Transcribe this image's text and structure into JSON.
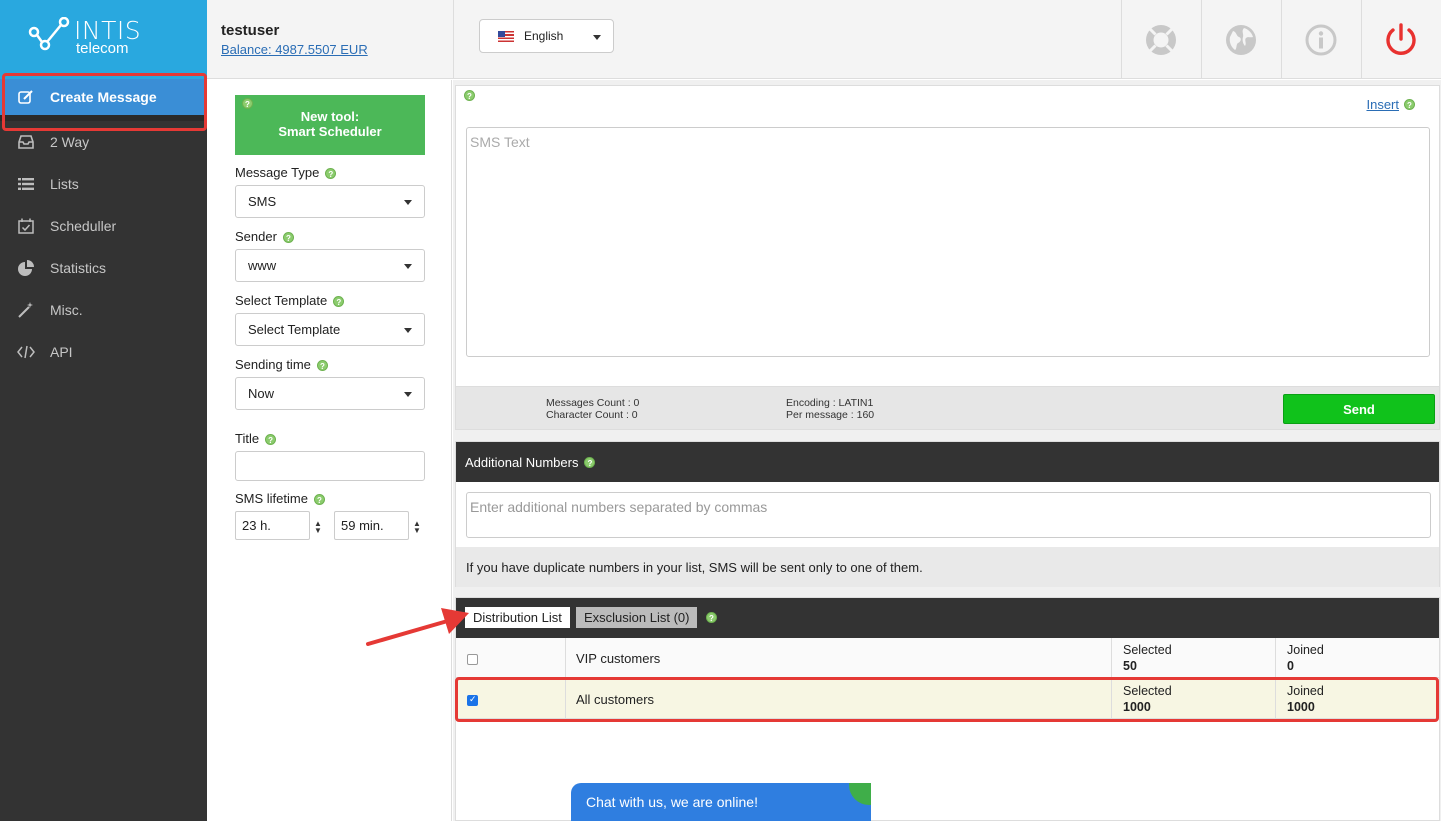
{
  "brand": {
    "line1": "INTIS",
    "line2": "telecom"
  },
  "sidebar": {
    "items": [
      {
        "label": "Create Message",
        "icon": "edit-icon",
        "active": true
      },
      {
        "label": "2 Way",
        "icon": "inbox-icon"
      },
      {
        "label": "Lists",
        "icon": "list-icon"
      },
      {
        "label": "Scheduller",
        "icon": "calendar-check-icon"
      },
      {
        "label": "Statistics",
        "icon": "pie-chart-icon"
      },
      {
        "label": "Misc.",
        "icon": "magic-wand-icon"
      },
      {
        "label": "API",
        "icon": "code-icon"
      }
    ]
  },
  "header": {
    "username": "testuser",
    "balance": "Balance: 4987.5507 EUR",
    "language": "English",
    "icons": [
      "lifebuoy-icon",
      "globe-icon",
      "info-icon",
      "power-icon"
    ]
  },
  "form": {
    "promo_line1": "New tool:",
    "promo_line2": "Smart Scheduler",
    "message_type_label": "Message Type",
    "message_type_value": "SMS",
    "sender_label": "Sender",
    "sender_value": "www",
    "template_label": "Select Template",
    "template_value": "Select Template",
    "sending_time_label": "Sending time",
    "sending_time_value": "Now",
    "title_label": "Title",
    "title_value": "",
    "lifetime_label": "SMS lifetime",
    "lifetime_hours": "23 h.",
    "lifetime_minutes": "59 min."
  },
  "sms": {
    "insert_label": "Insert",
    "placeholder": "SMS Text",
    "messages_count": "Messages Count : 0",
    "character_count": "Character Count : 0",
    "encoding": "Encoding : LATIN1",
    "per_message": "Per message : 160",
    "send_label": "Send"
  },
  "additional": {
    "title": "Additional Numbers",
    "placeholder": "Enter additional numbers separated by commas",
    "note": "If you have duplicate numbers in your list, SMS will be sent only to one of them."
  },
  "lists": {
    "tab_distribution": "Distribution List",
    "tab_exclusion": "Exsclusion List (0)",
    "rows": [
      {
        "name": "VIP customers",
        "checked": false,
        "selected_label": "Selected",
        "selected": "50",
        "joined_label": "Joined",
        "joined": "0"
      },
      {
        "name": "All customers",
        "checked": true,
        "selected_label": "Selected",
        "selected": "1000",
        "joined_label": "Joined",
        "joined": "1000"
      }
    ]
  },
  "chat": {
    "label": "Chat with us, we are online!"
  },
  "colors": {
    "accent": "#29a8df",
    "active": "#3a8ed6",
    "send": "#10c21b",
    "highlight": "#f7f6e3",
    "annotation": "#e53935"
  }
}
